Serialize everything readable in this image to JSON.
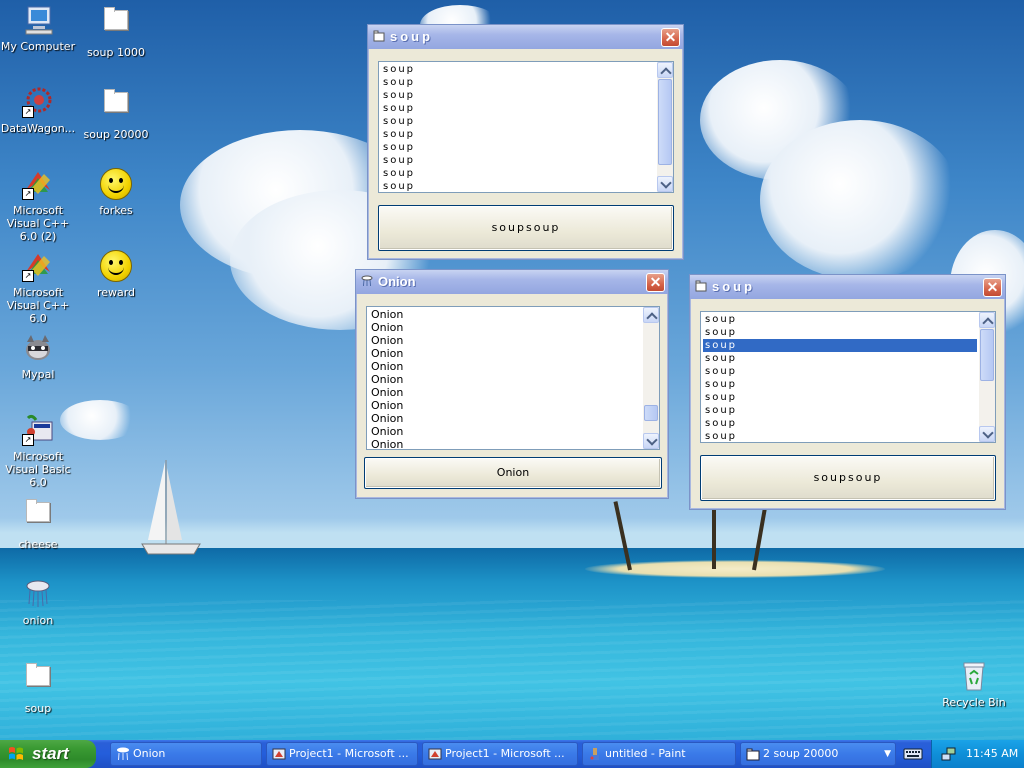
{
  "desktop": {
    "icons": [
      {
        "label": "My Computer"
      },
      {
        "label": "soup 1000"
      },
      {
        "label": "DataWagon..."
      },
      {
        "label": "soup 20000"
      },
      {
        "label": "Microsoft Visual C++ 6.0 (2)"
      },
      {
        "label": "forkes"
      },
      {
        "label": "Microsoft Visual C++ 6.0"
      },
      {
        "label": "reward"
      },
      {
        "label": "Mypal"
      },
      {
        "label": "Microsoft Visual Basic 6.0"
      },
      {
        "label": "cheese"
      },
      {
        "label": "onion"
      },
      {
        "label": "soup"
      },
      {
        "label": "Recycle Bin"
      }
    ]
  },
  "windows": {
    "soup_top": {
      "title": "soup",
      "items": [
        "soup",
        "soup",
        "soup",
        "soup",
        "soup",
        "soup",
        "soup",
        "soup",
        "soup",
        "soup"
      ],
      "button": "soupsoup"
    },
    "onion": {
      "title": "Onion",
      "items": [
        "Onion",
        "Onion",
        "Onion",
        "Onion",
        "Onion",
        "Onion",
        "Onion",
        "Onion",
        "Onion",
        "Onion",
        "Onion"
      ],
      "button": "Onion"
    },
    "soup_right": {
      "title": "soup",
      "items": [
        "soup",
        "soup",
        "soup",
        "soup",
        "soup",
        "soup",
        "soup",
        "soup",
        "soup",
        "soup"
      ],
      "selected_index": 2,
      "button": "soupsoup"
    }
  },
  "taskbar": {
    "start": "start",
    "tasks": [
      {
        "label": "Onion"
      },
      {
        "label": "Project1 - Microsoft ..."
      },
      {
        "label": "Project1 - Microsoft ..."
      },
      {
        "label": "untitled - Paint"
      },
      {
        "label": "2 soup 20000"
      }
    ],
    "clock": "11:45 AM"
  },
  "colors": {
    "accent": "#245edb",
    "selection": "#316ac5",
    "start_green": "#3a9a33"
  }
}
